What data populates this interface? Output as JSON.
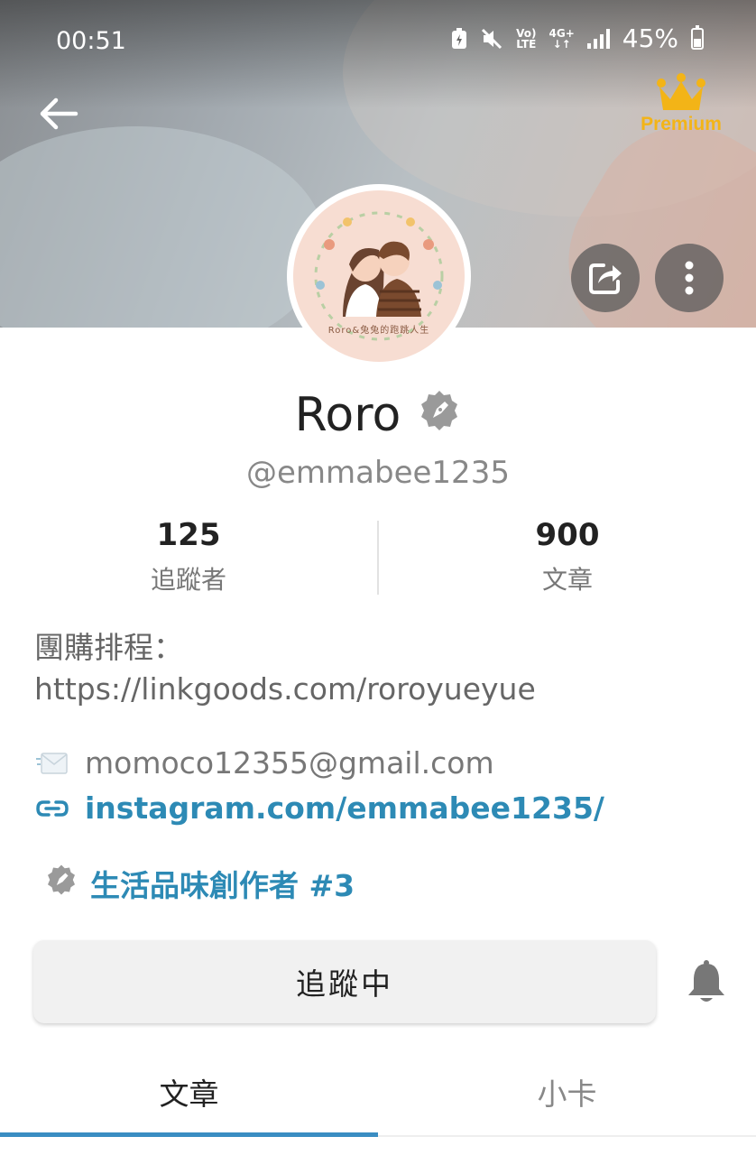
{
  "status_bar": {
    "time": "00:51",
    "network_volte": "Vo)",
    "network_lte": "LTE",
    "network_type": "4G+",
    "battery": "45%"
  },
  "header": {
    "back_icon": "arrow-left-icon",
    "premium_label": "Premium",
    "premium_color": "#f3b417",
    "share_icon": "share-icon",
    "more_icon": "more-vertical-icon"
  },
  "profile": {
    "avatar_caption": "Roro&兔兔的跑跳人生",
    "name": "Roro",
    "handle": "@emmabee1235",
    "stats": [
      {
        "value": "125",
        "label": "追蹤者"
      },
      {
        "value": "900",
        "label": "文章"
      }
    ],
    "bio": "團購排程：\nhttps://linkgoods.com/roroyueyue",
    "email": "momoco12355@gmail.com",
    "instagram": "instagram.com/emmabee1235/",
    "creator_rank": "生活品味創作者 #3"
  },
  "actions": {
    "follow_label": "追蹤中",
    "bell_icon": "bell-icon"
  },
  "tabs": [
    {
      "label": "文章",
      "active": true
    },
    {
      "label": "小卡",
      "active": false
    }
  ],
  "colors": {
    "accent": "#2d8ab5",
    "tab_indicator": "#3a8dc2"
  }
}
